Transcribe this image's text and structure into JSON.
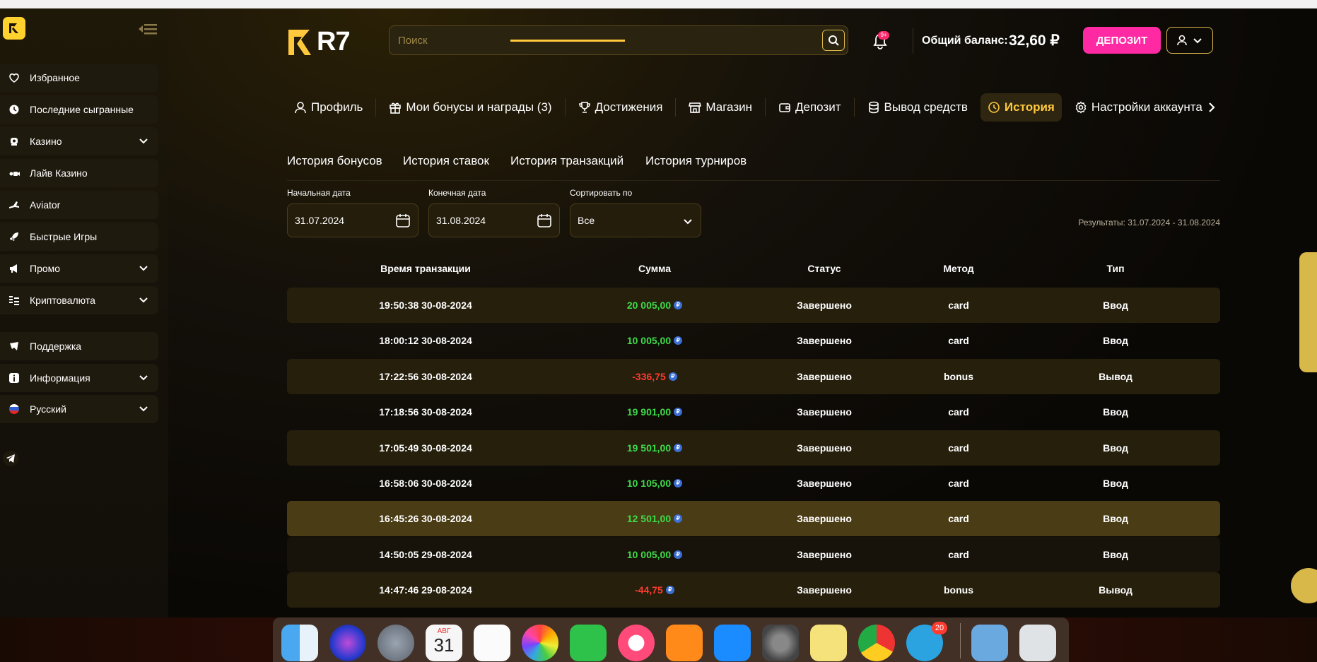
{
  "sidebar": {
    "items": [
      {
        "label": "Избранное",
        "icon": "heart-icon",
        "expandable": false
      },
      {
        "label": "Последние сыгранные",
        "icon": "clock-icon",
        "expandable": false
      },
      {
        "label": "Казино",
        "icon": "casino-icon",
        "expandable": true
      },
      {
        "label": "Лайв Казино",
        "icon": "live-casino-icon",
        "expandable": false
      },
      {
        "label": "Aviator",
        "icon": "plane-icon",
        "expandable": false
      },
      {
        "label": "Быстрые Игры",
        "icon": "rocket-icon",
        "expandable": false
      },
      {
        "label": "Промо",
        "icon": "megaphone-icon",
        "expandable": true
      },
      {
        "label": "Криптовалюта",
        "icon": "crypto-icon",
        "expandable": true
      },
      {
        "label": "Поддержка",
        "icon": "support-icon",
        "expandable": false
      },
      {
        "label": "Информация",
        "icon": "info-icon",
        "expandable": true
      },
      {
        "label": "Русский",
        "icon": "russia-flag-icon",
        "expandable": true
      }
    ]
  },
  "header": {
    "brand": "R7",
    "search_placeholder": "Поиск",
    "notifications_badge": "9+",
    "balance_label": "Общий баланс:",
    "balance_value": "32,60 ₽",
    "deposit_label": "ДЕПОЗИТ"
  },
  "tabs": [
    {
      "label": "Профиль",
      "icon": "user-icon",
      "active": false
    },
    {
      "label": "Мои бонусы и награды (3)",
      "icon": "gift-icon",
      "active": false
    },
    {
      "label": "Достижения",
      "icon": "trophy-icon",
      "active": false
    },
    {
      "label": "Магазин",
      "icon": "store-icon",
      "active": false
    },
    {
      "label": "Депозит",
      "icon": "wallet-icon",
      "active": false
    },
    {
      "label": "Вывод средств",
      "icon": "coins-icon",
      "active": false
    },
    {
      "label": "История",
      "icon": "history-icon",
      "active": true
    },
    {
      "label": "Настройки аккаунта",
      "icon": "gear-icon",
      "active": false
    }
  ],
  "subtabs": {
    "bonus_history": "История бонусов",
    "bet_history": "История ставок",
    "transaction_history": "История транзакций",
    "tournament_history": "История турниров"
  },
  "filters": {
    "start_label": "Начальная дата",
    "start_value": "31.07.2024",
    "end_label": "Конечная дата",
    "end_value": "31.08.2024",
    "sort_label": "Сортировать по",
    "sort_value": "Все",
    "results_text": "Результаты: 31.07.2024 - 31.08.2024"
  },
  "table": {
    "headers": [
      "Время транзакции",
      "Сумма",
      "Статус",
      "Метод",
      "Тип"
    ],
    "rows": [
      {
        "time": "19:50:38 30-08-2024",
        "amount": "20 005,00",
        "sign": "pos",
        "status": "Завершено",
        "method": "card",
        "type": "Ввод"
      },
      {
        "time": "18:00:12 30-08-2024",
        "amount": "10 005,00",
        "sign": "pos",
        "status": "Завершено",
        "method": "card",
        "type": "Ввод"
      },
      {
        "time": "17:22:56 30-08-2024",
        "amount": "-336,75",
        "sign": "neg",
        "status": "Завершено",
        "method": "bonus",
        "type": "Вывод"
      },
      {
        "time": "17:18:56 30-08-2024",
        "amount": "19 901,00",
        "sign": "pos",
        "status": "Завершено",
        "method": "card",
        "type": "Ввод"
      },
      {
        "time": "17:05:49 30-08-2024",
        "amount": "19 501,00",
        "sign": "pos",
        "status": "Завершено",
        "method": "card",
        "type": "Ввод"
      },
      {
        "time": "16:58:06 30-08-2024",
        "amount": "10 105,00",
        "sign": "pos",
        "status": "Завершено",
        "method": "card",
        "type": "Ввод"
      },
      {
        "time": "16:45:26 30-08-2024",
        "amount": "12 501,00",
        "sign": "pos",
        "status": "Завершено",
        "method": "card",
        "type": "Ввод"
      },
      {
        "time": "14:50:05 29-08-2024",
        "amount": "10 005,00",
        "sign": "pos",
        "status": "Завершено",
        "method": "card",
        "type": "Ввод"
      },
      {
        "time": "14:47:46 29-08-2024",
        "amount": "-44,75",
        "sign": "neg",
        "status": "Завершено",
        "method": "bonus",
        "type": "Вывод"
      }
    ]
  },
  "dock": {
    "calendar_month": "АВГ",
    "calendar_day": "31",
    "telegram_badge": "20"
  },
  "colors": {
    "accent": "#ffc83d",
    "deposit": "#ff2aa3",
    "positive": "#3ddc4a",
    "negative": "#ff3b30"
  }
}
